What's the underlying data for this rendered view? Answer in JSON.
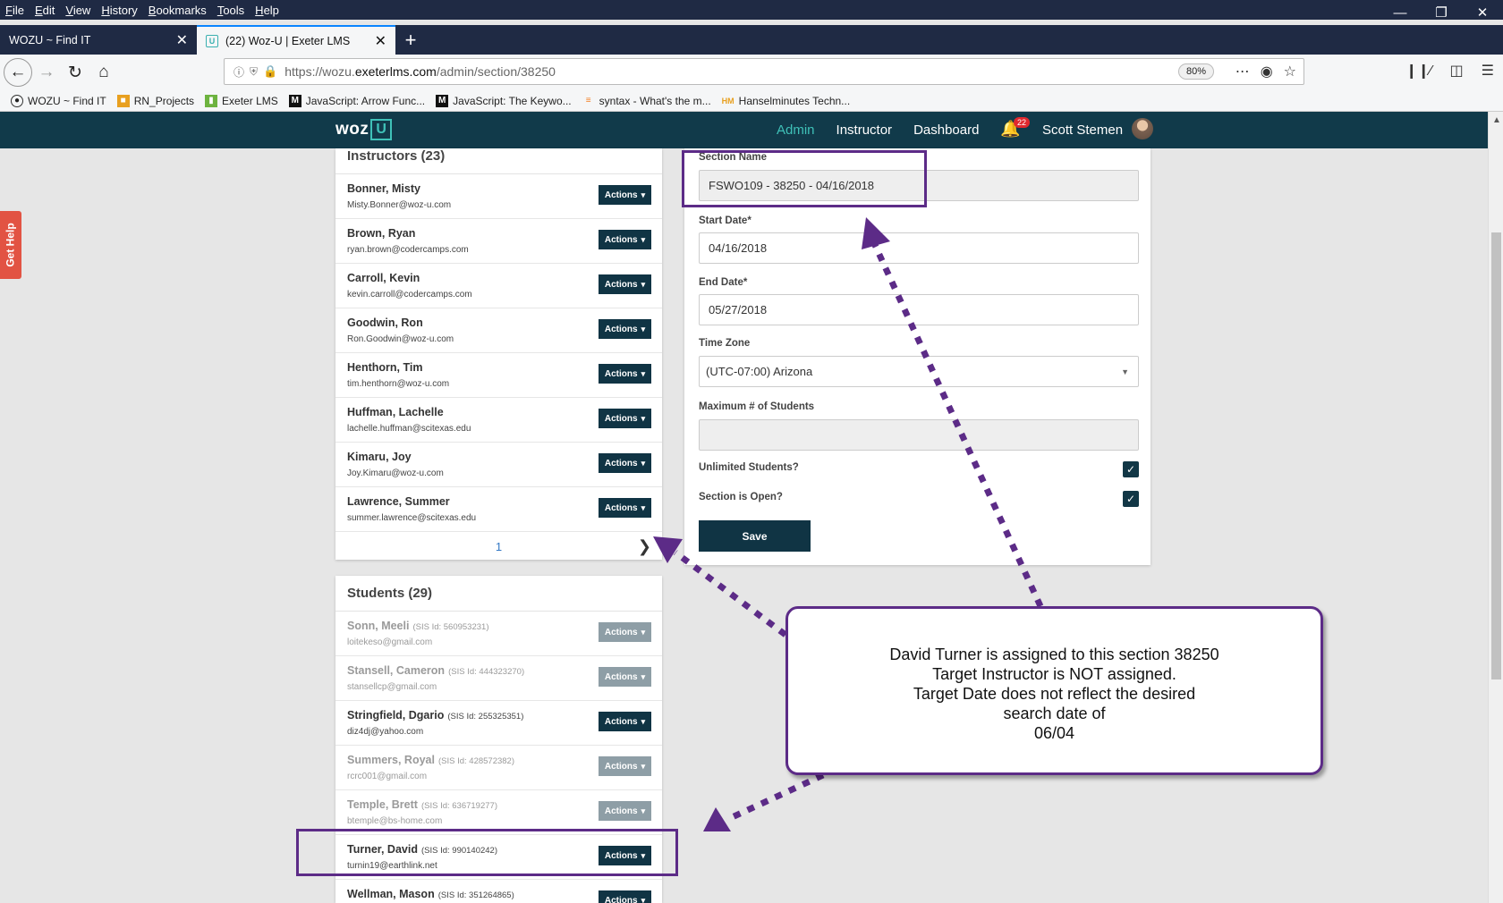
{
  "browser": {
    "menu": [
      "File",
      "Edit",
      "View",
      "History",
      "Bookmarks",
      "Tools",
      "Help"
    ],
    "tabs": [
      {
        "label": "WOZU ~ Find IT",
        "active": false
      },
      {
        "label": "(22) Woz-U | Exeter LMS",
        "active": true
      }
    ],
    "url_prefix": "https://wozu.",
    "url_host": "exeterlms.com",
    "url_path": "/admin/section/38250",
    "zoom": "80%",
    "bookmarks": [
      {
        "label": "WOZU ~ Find IT",
        "icon": "globe-icon"
      },
      {
        "label": "RN_Projects",
        "icon": "folder-icon"
      },
      {
        "label": "Exeter LMS",
        "icon": "book-icon"
      },
      {
        "label": "JavaScript: Arrow Func...",
        "icon": "medium-icon"
      },
      {
        "label": "JavaScript: The Keywo...",
        "icon": "medium-icon"
      },
      {
        "label": "syntax - What's the m...",
        "icon": "stack-icon"
      },
      {
        "label": "Hanselminutes Techn...",
        "icon": "hm-icon"
      }
    ]
  },
  "header": {
    "logo_text": "woz",
    "logo_u": "U",
    "nav": [
      "Admin",
      "Instructor",
      "Dashboard"
    ],
    "notifications": "22",
    "user_name": "Scott Stemen"
  },
  "help_tab": "Get Help",
  "instructors": {
    "title": "Instructors (23)",
    "items": [
      {
        "name": "Bonner, Misty",
        "email": "Misty.Bonner@woz-u.com"
      },
      {
        "name": "Brown, Ryan",
        "email": "ryan.brown@codercamps.com"
      },
      {
        "name": "Carroll, Kevin",
        "email": "kevin.carroll@codercamps.com"
      },
      {
        "name": "Goodwin, Ron",
        "email": "Ron.Goodwin@woz-u.com"
      },
      {
        "name": "Henthorn, Tim",
        "email": "tim.henthorn@woz-u.com"
      },
      {
        "name": "Huffman, Lachelle",
        "email": "lachelle.huffman@scitexas.edu"
      },
      {
        "name": "Kimaru, Joy",
        "email": "Joy.Kimaru@woz-u.com"
      },
      {
        "name": "Lawrence, Summer",
        "email": "summer.lawrence@scitexas.edu"
      }
    ],
    "page": "1",
    "actions_label": "Actions"
  },
  "students": {
    "title": "Students (29)",
    "items": [
      {
        "name": "Sonn, Meeli",
        "sis": "(SIS Id: 560953231)",
        "email": "loitekeso@gmail.com",
        "muted": true
      },
      {
        "name": "Stansell, Cameron",
        "sis": "(SIS Id: 444323270)",
        "email": "stansellcp@gmail.com",
        "muted": true
      },
      {
        "name": "Stringfield, Dgario",
        "sis": "(SIS Id: 255325351)",
        "email": "diz4dj@yahoo.com",
        "muted": false
      },
      {
        "name": "Summers, Royal",
        "sis": "(SIS Id: 428572382)",
        "email": "rcrc001@gmail.com",
        "muted": true
      },
      {
        "name": "Temple, Brett",
        "sis": "(SIS Id: 636719277)",
        "email": "btemple@bs-home.com",
        "muted": true
      },
      {
        "name": "Turner, David",
        "sis": "(SIS Id: 990140242)",
        "email": "turnin19@earthlink.net",
        "muted": false
      },
      {
        "name": "Wellman, Mason",
        "sis": "(SIS Id: 351264865)",
        "email": "",
        "muted": false
      }
    ],
    "actions_label": "Actions"
  },
  "form": {
    "section_name_label": "Section Name",
    "section_name_value": "FSWO109 - 38250 - 04/16/2018",
    "start_date_label": "Start Date*",
    "start_date_value": "04/16/2018",
    "end_date_label": "End Date*",
    "end_date_value": "05/27/2018",
    "time_zone_label": "Time Zone",
    "time_zone_value": "(UTC-07:00) Arizona",
    "max_students_label": "Maximum # of Students",
    "max_students_value": "",
    "unlimited_label": "Unlimited Students?",
    "unlimited_checked": true,
    "open_label": "Section is Open?",
    "open_checked": true,
    "save_label": "Save"
  },
  "callout": {
    "lines": [
      "David Turner is assigned to this section 38250",
      "Target Instructor is NOT assigned.",
      "Target Date does not reflect the desired",
      "search date of",
      "06/04"
    ]
  },
  "colors": {
    "header_bg": "#113a4a",
    "accent": "#3fc1b8",
    "button": "#103444",
    "annotation": "#5c2b87",
    "help_tab": "#e25343"
  }
}
